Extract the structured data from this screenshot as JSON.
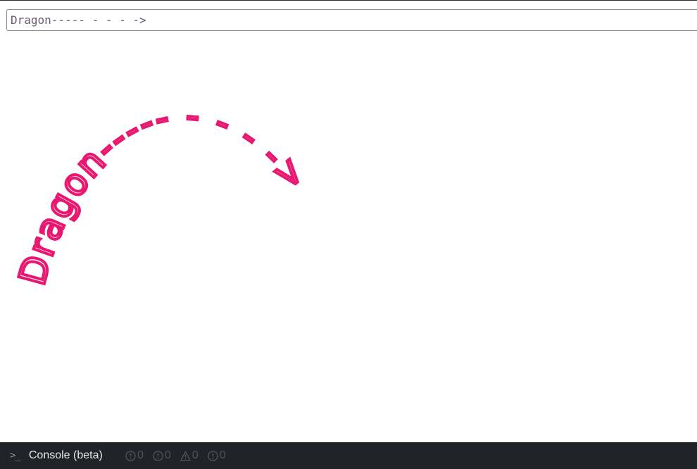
{
  "path_input": {
    "value": "Dragon----- - - - ->"
  },
  "canvas": {
    "text": "Dragon----- - - - ->",
    "color": "#e8176f"
  },
  "console_bar": {
    "label": "Console (beta)",
    "prompt_icon": ">_",
    "counters": [
      {
        "icon": "info-circle-icon",
        "count": "0"
      },
      {
        "icon": "error-circle-icon",
        "count": "0"
      },
      {
        "icon": "warning-triangle-icon",
        "count": "0"
      },
      {
        "icon": "log-circle-icon",
        "count": "0"
      }
    ]
  }
}
